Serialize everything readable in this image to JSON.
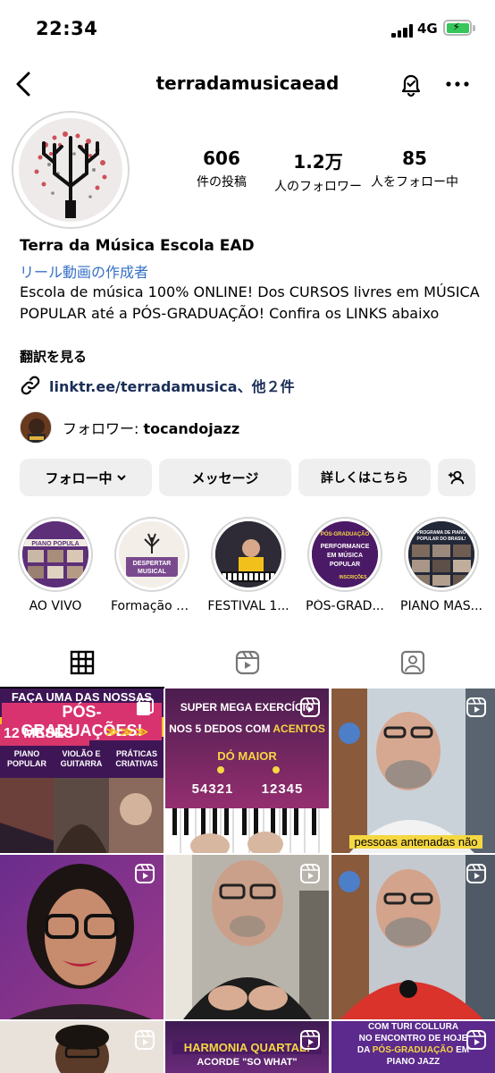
{
  "status": {
    "time": "22:34",
    "network": "4G"
  },
  "header": {
    "username": "terradamusicaead"
  },
  "profile": {
    "posts_count": "606",
    "posts_label": "件の投稿",
    "followers_count": "1.2万",
    "followers_label": "人のフォロワー",
    "following_count": "85",
    "following_label": "人をフォロー中",
    "name": "Terra da Música Escola EAD",
    "category": "リール動画の作成者",
    "bio": "Escola de música 100% ONLINE! Dos CURSOS livres em MÚSICA POPULAR até a PÓS-GRADUAÇÃO! Confira os LINKS abaixo",
    "translate": "翻訳を見る",
    "link": "linktr.ee/terradamusica、他２件",
    "mutual_prefix": "フォロワー: ",
    "mutual_name": "tocandojazz"
  },
  "buttons": {
    "follow": "フォロー中",
    "message": "メッセージ",
    "contact": "詳しくはこちら"
  },
  "highlights": [
    {
      "label": "AO VIVO",
      "thumb_text": "PIANO POPULA"
    },
    {
      "label": "Formação E...",
      "thumb_text": "DESPERTAR MUSICAL"
    },
    {
      "label": "FESTIVAL 1...",
      "thumb_text": ""
    },
    {
      "label": "PÓS-GRAD...",
      "thumb_text": "PERFORMANCE EM MÚSICA POPULAR"
    },
    {
      "label": "PIANO MAS...",
      "thumb_text": "PROGRAMA DE PIANO POPULAR DO BRASIL!"
    }
  ],
  "posts": {
    "p1": {
      "top": "FAÇA UMA DAS NOSSAS",
      "title": "PÓS-GRADUAÇÕES!",
      "badge": "12 MESES",
      "c1": "PIANO POPULAR",
      "c2": "VIOLÃO E GUITARRA",
      "c3": "PRÁTICAS CRIATIVAS"
    },
    "p2": {
      "line1": "SUPER MEGA EXERCÍCIO",
      "line2a": "NOS 5 DEDOS COM ",
      "line2b": "ACENTOS",
      "key": "DÓ MAIOR",
      "fingers1": "54321",
      "fingers2": "12345"
    },
    "p3": {
      "caption": "pessoas antenadas não"
    },
    "p8": {
      "line1": "HARMONIA QUARTAL:",
      "line2": "ACORDE \"SO WHAT\""
    },
    "p9": {
      "line1": "COM TURI COLLURA",
      "line2": "NO ENCONTRO DE HOJE",
      "line3a": "DA ",
      "line3b": "PÓS-GRADUAÇÃO",
      "line3c": " EM",
      "line4": "PIANO JAZZ"
    }
  },
  "colors": {
    "link_blue": "#3770c6",
    "button_bg": "#efefef",
    "highlight_yellow": "#f5d742"
  }
}
